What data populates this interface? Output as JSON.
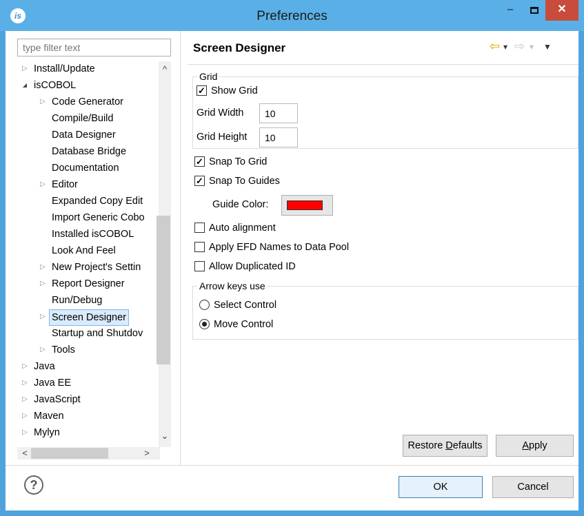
{
  "window": {
    "title": "Preferences",
    "app_icon_text": "is",
    "min_glyph": "–",
    "close_glyph": "✕"
  },
  "filter": {
    "placeholder": "type filter text"
  },
  "tree": {
    "items": [
      {
        "label": "Install/Update",
        "twisty": "▷"
      },
      {
        "label": "isCOBOL",
        "twisty": "◢"
      },
      {
        "label": "Code Generator",
        "twisty": "▷"
      },
      {
        "label": "Compile/Build"
      },
      {
        "label": "Data Designer"
      },
      {
        "label": "Database Bridge"
      },
      {
        "label": "Documentation"
      },
      {
        "label": "Editor",
        "twisty": "▷"
      },
      {
        "label": "Expanded Copy Edit"
      },
      {
        "label": "Import Generic Cobo"
      },
      {
        "label": "Installed isCOBOL"
      },
      {
        "label": "Look And Feel"
      },
      {
        "label": "New Project's Settin",
        "twisty": "▷"
      },
      {
        "label": "Report Designer",
        "twisty": "▷"
      },
      {
        "label": "Run/Debug"
      },
      {
        "label": "Screen Designer",
        "twisty": "▷",
        "selected": true
      },
      {
        "label": "Startup and Shutdov"
      },
      {
        "label": "Tools",
        "twisty": "▷"
      },
      {
        "label": "Java",
        "twisty": "▷"
      },
      {
        "label": "Java EE",
        "twisty": "▷"
      },
      {
        "label": "JavaScript",
        "twisty": "▷"
      },
      {
        "label": "Maven",
        "twisty": "▷"
      },
      {
        "label": "Mylyn",
        "twisty": "▷"
      }
    ],
    "scroll_up": "^",
    "scroll_down": "⌄",
    "scroll_left": "<",
    "scroll_right": ">"
  },
  "page": {
    "title": "Screen Designer",
    "nav": {
      "back": "⇦",
      "dropdown": "▾",
      "forward": "⇨",
      "menu": "▼"
    }
  },
  "grid": {
    "group_label": "Grid",
    "show_grid": {
      "label": "Show Grid",
      "checked": true,
      "mark": "✓"
    },
    "width_label": "Grid Width",
    "width_value": "10",
    "height_label": "Grid Height",
    "height_value": "10"
  },
  "options": {
    "snap_to_grid": {
      "label": "Snap To Grid",
      "checked": true
    },
    "snap_to_guides": {
      "label": "Snap To Guides",
      "checked": true
    },
    "guide_color_label": "Guide Color:",
    "guide_color": "#ff0000",
    "auto_alignment": {
      "label": "Auto alignment",
      "checked": false
    },
    "apply_efd": {
      "label": "Apply EFD Names to Data Pool",
      "checked": false
    },
    "allow_dup": {
      "label": "Allow Duplicated ID",
      "checked": false
    },
    "check_mark": "✓"
  },
  "arrow_keys": {
    "group_label": "Arrow keys use",
    "select_control": "Select Control",
    "move_control": "Move Control",
    "selected": "Move Control"
  },
  "buttons": {
    "restore_prefix": "Restore ",
    "restore_mnemonic": "D",
    "restore_suffix": "efaults",
    "apply_mnemonic": "A",
    "apply_suffix": "pply",
    "ok": "OK",
    "cancel": "Cancel",
    "help": "?"
  },
  "colors": {
    "title_bar": "#5ab0e6",
    "close_button": "#c74c3c",
    "selection": "#d9ebfb",
    "guide_color": "#ff0000"
  }
}
